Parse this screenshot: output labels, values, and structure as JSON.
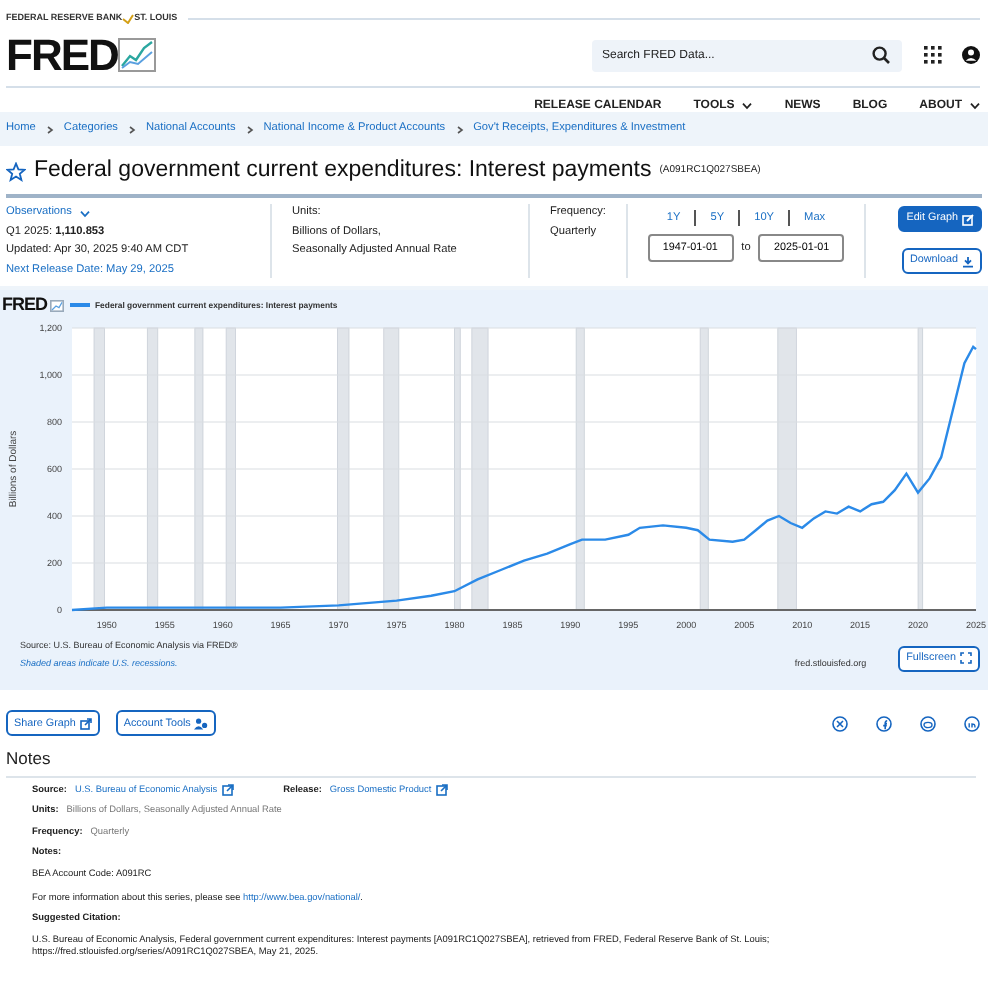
{
  "header": {
    "bank_left": "FEDERAL RESERVE BANK",
    "bank_right": "ST. LOUIS",
    "logo": "FRED",
    "search": {
      "placeholder": "Search FRED Data..."
    },
    "nav": [
      {
        "label": "RELEASE CALENDAR",
        "dropdown": false
      },
      {
        "label": "TOOLS",
        "dropdown": true
      },
      {
        "label": "NEWS",
        "dropdown": false
      },
      {
        "label": "BLOG",
        "dropdown": false
      },
      {
        "label": "ABOUT",
        "dropdown": true
      }
    ]
  },
  "breadcrumbs": [
    "Home",
    "Categories",
    "National Accounts",
    "National Income & Product Accounts",
    "Gov't Receipts, Expenditures & Investment"
  ],
  "series": {
    "title": "Federal government current expenditures: Interest payments",
    "id": "(A091RC1Q027SBEA)",
    "favorite": false
  },
  "observations": {
    "label": "Observations",
    "latest_label": "Q1 2025:",
    "latest_value": "1,110.853",
    "updated": "Updated: Apr 30, 2025 9:40 AM CDT",
    "next_release": "Next Release Date: May 29, 2025"
  },
  "units": {
    "label": "Units:",
    "lines": [
      "Billions of Dollars,",
      "Seasonally Adjusted Annual Rate"
    ]
  },
  "frequency": {
    "label": "Frequency:",
    "value": "Quarterly"
  },
  "ranges": [
    "1Y",
    "5Y",
    "10Y",
    "Max"
  ],
  "date_range": {
    "from": "1947-01-01",
    "separator": "to",
    "to": "2025-01-01"
  },
  "actions": [
    {
      "label": "Edit Graph",
      "kind": "primary"
    },
    {
      "label": "Download",
      "kind": "outline"
    }
  ],
  "graph": {
    "logo": "FRED",
    "chart_data": {
      "type": "line",
      "ylabel": "Billions of Dollars",
      "xlim": [
        1947,
        2025
      ],
      "ylim": [
        0,
        1200
      ],
      "xticks": [
        1950,
        1955,
        1960,
        1965,
        1970,
        1975,
        1980,
        1985,
        1990,
        1995,
        2000,
        2005,
        2010,
        2015,
        2020,
        2025
      ],
      "yticks": [
        {
          "value": 0,
          "label": "0"
        },
        {
          "value": 200,
          "label": "200"
        },
        {
          "value": 400,
          "label": "400"
        },
        {
          "value": 600,
          "label": "600"
        },
        {
          "value": 800,
          "label": "800"
        },
        {
          "value": 1000,
          "label": "1,000"
        },
        {
          "value": 1200,
          "label": "1,200"
        }
      ],
      "x": [
        1947,
        1950,
        1955,
        1960,
        1965,
        1970,
        1975,
        1978,
        1980,
        1982,
        1984,
        1986,
        1988,
        1990,
        1991,
        1993,
        1995,
        1996,
        1998,
        2000,
        2001,
        2002,
        2004,
        2005,
        2006,
        2007,
        2008,
        2009,
        2010,
        2011,
        2012,
        2013,
        2014,
        2015,
        2016,
        2017,
        2018,
        2019,
        2020,
        2021,
        2022,
        2023,
        2024,
        2024.75,
        2025
      ],
      "grid": true,
      "series": [
        {
          "name": "Federal government current expenditures: Interest payments",
          "color": "#2b8ae8",
          "values": [
            0,
            10,
            10,
            10,
            10,
            20,
            40,
            60,
            80,
            130,
            170,
            210,
            240,
            280,
            300,
            300,
            320,
            350,
            360,
            350,
            340,
            300,
            290,
            300,
            340,
            380,
            400,
            370,
            350,
            390,
            420,
            410,
            440,
            420,
            450,
            460,
            510,
            580,
            500,
            560,
            650,
            850,
            1050,
            1120,
            1110
          ]
        }
      ]
    },
    "source": "Source: U.S. Bureau of Economic Analysis via FRED®",
    "shading_note": "Shaded areas indicate U.S. recessions.",
    "site": "fred.stlouisfed.org",
    "fullscreen": "Fullscreen"
  },
  "tools": [
    "Share Graph",
    "Account Tools"
  ],
  "notes": {
    "heading": "Notes",
    "source_label": "Source:",
    "source_link": "U.S. Bureau of Economic Analysis",
    "release_label": "Release:",
    "release_link": "Gross Domestic Product",
    "units_label": "Units:",
    "units_value": "Billions of Dollars, Seasonally Adjusted Annual Rate",
    "frequency_label": "Frequency:",
    "frequency_value": "Quarterly",
    "notes_label": "Notes:",
    "account_code": "BEA Account Code: A091RC",
    "more_before": "For more information about this series, please see ",
    "more_link": "http://www.bea.gov/national/",
    "more_after": ".",
    "citation_label": "Suggested Citation:",
    "citation": "U.S. Bureau of Economic Analysis, Federal government current expenditures: Interest payments [A091RC1Q027SBEA], retrieved from FRED, Federal Reserve Bank of St. Louis; https://fred.stlouisfed.org/series/A091RC1Q027SBEA, May 21, 2025."
  }
}
